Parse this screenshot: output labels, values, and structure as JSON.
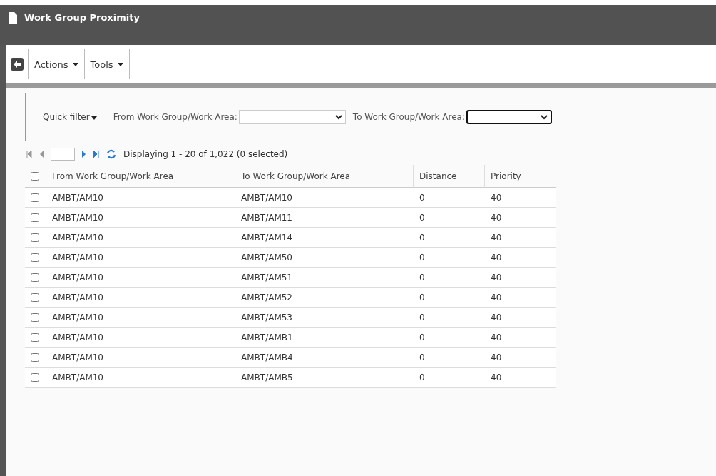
{
  "window": {
    "title": "Work Group Proximity"
  },
  "toolbar": {
    "menus": [
      {
        "access_key": "A",
        "label_rest": "ctions"
      },
      {
        "access_key": "T",
        "label_rest": "ools"
      }
    ]
  },
  "filter_bar": {
    "quick_filter": "Quick filter",
    "filters": [
      {
        "label": "From Work Group/Work Area:",
        "focused": false
      },
      {
        "label": "To Work Group/Work Area:",
        "focused": true
      }
    ]
  },
  "pager": {
    "status": "Displaying 1 - 20 of 1,022 (0 selected)"
  },
  "table": {
    "all_checked": false,
    "columns": [
      "From Work Group/Work Area",
      "To Work Group/Work Area",
      "Distance",
      "Priority"
    ],
    "rows": [
      {
        "checked": false,
        "cells": [
          "AMBT/AM10",
          "AMBT/AM10",
          "0",
          "40"
        ]
      },
      {
        "checked": false,
        "cells": [
          "AMBT/AM10",
          "AMBT/AM11",
          "0",
          "40"
        ]
      },
      {
        "checked": false,
        "cells": [
          "AMBT/AM10",
          "AMBT/AM14",
          "0",
          "40"
        ]
      },
      {
        "checked": false,
        "cells": [
          "AMBT/AM10",
          "AMBT/AM50",
          "0",
          "40"
        ]
      },
      {
        "checked": false,
        "cells": [
          "AMBT/AM10",
          "AMBT/AM51",
          "0",
          "40"
        ]
      },
      {
        "checked": false,
        "cells": [
          "AMBT/AM10",
          "AMBT/AM52",
          "0",
          "40"
        ]
      },
      {
        "checked": false,
        "cells": [
          "AMBT/AM10",
          "AMBT/AM53",
          "0",
          "40"
        ]
      },
      {
        "checked": false,
        "cells": [
          "AMBT/AM10",
          "AMBT/AMB1",
          "0",
          "40"
        ]
      },
      {
        "checked": false,
        "cells": [
          "AMBT/AM10",
          "AMBT/AMB4",
          "0",
          "40"
        ]
      },
      {
        "checked": false,
        "cells": [
          "AMBT/AM10",
          "AMBT/AMB5",
          "0",
          "40"
        ]
      }
    ]
  }
}
